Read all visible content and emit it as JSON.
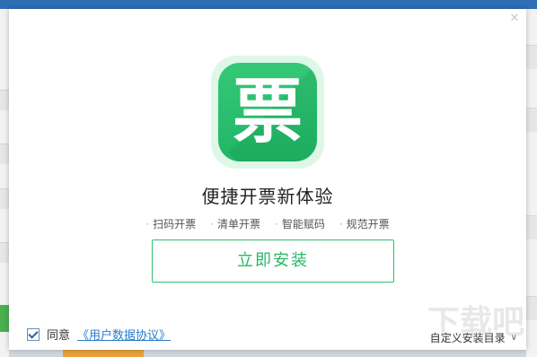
{
  "logo": {
    "glyph": "票",
    "color": "#21b666"
  },
  "headline": "便捷开票新体验",
  "features": [
    "扫码开票",
    "清单开票",
    "智能赋码",
    "规范开票"
  ],
  "install_button": "立即安装",
  "agreement": {
    "checked": true,
    "label": "同意",
    "link": "《用户数据协议》"
  },
  "custom_dir": {
    "label": "自定义安装目录"
  },
  "watermark": "下载吧",
  "colors": {
    "accent": "#2fbf70",
    "link": "#2a7ccf",
    "titlebar": "#2f6eb5"
  }
}
